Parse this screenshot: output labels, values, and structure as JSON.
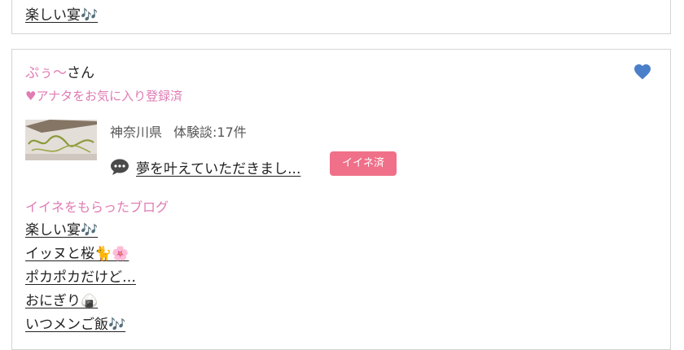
{
  "top_card": {
    "blog_title": "楽しい宴🎶"
  },
  "user": {
    "name": "ぷぅ〜",
    "honorific": "さん",
    "favorite_status": "♥アナタをお気に入り登録済",
    "prefecture": "神奈川県",
    "experience_count": "体験談:17件",
    "latest_blog": "夢を叶えていただきまし...",
    "iine_badge": "イイネ済"
  },
  "liked_blogs": {
    "title": "イイネをもらったブログ",
    "items": [
      "楽しい宴🎶",
      "イッヌと桜🐈🌸",
      "ポカポカだけど…",
      "おにぎり🍙",
      "いつメンご飯🎶"
    ]
  },
  "colors": {
    "accent_pink": "#e07bb3",
    "badge_pink": "#f07089",
    "heart_blue": "#4a7fc9"
  },
  "icons": {
    "favorite_toggle": "heart-icon",
    "comment": "speech-bubble-icon"
  }
}
